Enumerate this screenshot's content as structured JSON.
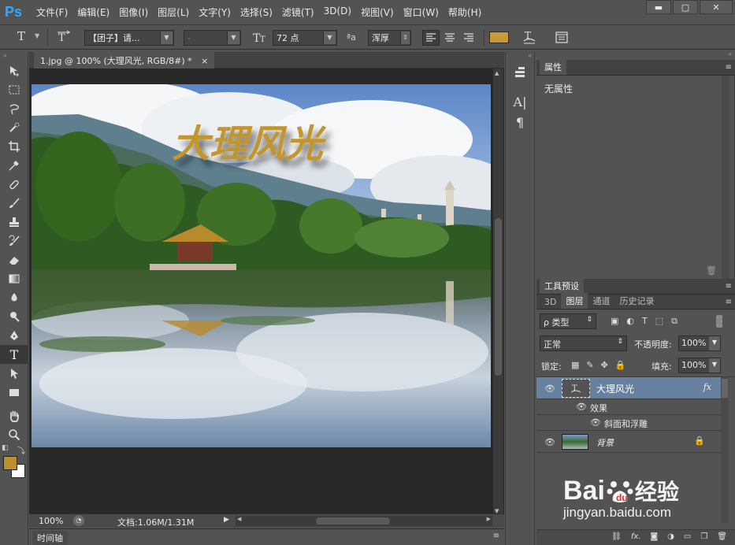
{
  "app": {
    "logo": "Ps",
    "menu": [
      "文件(F)",
      "编辑(E)",
      "图像(I)",
      "图层(L)",
      "文字(Y)",
      "选择(S)",
      "滤镜(T)",
      "3D(D)",
      "视图(V)",
      "窗口(W)",
      "帮助(H)"
    ],
    "window_controls": [
      "▬",
      "▢",
      "✕"
    ]
  },
  "options": {
    "font_family": "【团子】请...",
    "font_style": "-",
    "font_size": "72 点",
    "aa_label": "ªa",
    "antialias": "浑厚",
    "text_color": "#c89a3a"
  },
  "document": {
    "tab_title": "1.jpg @ 100% (大理风光, RGB/8#) *",
    "tab_close": "×",
    "canvas_title": "大理风光",
    "zoom": "100%",
    "doc_info": "文档:1.06M/1.31M",
    "timeline_label": "时间轴"
  },
  "colors": {
    "foreground": "#b8902f",
    "background": "#ffffff"
  },
  "properties": {
    "tab": "属性",
    "content": "无属性"
  },
  "tool_presets": {
    "tab": "工具预设"
  },
  "layers": {
    "tabs": [
      "3D",
      "图层",
      "通道",
      "历史记录"
    ],
    "filter_label": "ρ 类型",
    "blend_mode": "正常",
    "opacity_label": "不透明度:",
    "opacity_value": "100%",
    "lock_label": "锁定:",
    "fill_label": "填充:",
    "fill_value": "100%",
    "items": [
      {
        "name": "大理风光",
        "type": "text",
        "fx": "fx"
      },
      {
        "name": "效果",
        "type": "effect-group"
      },
      {
        "name": "斜面和浮雕",
        "type": "effect"
      },
      {
        "name": "背景",
        "type": "image"
      }
    ]
  },
  "watermark": {
    "brand": "Bai",
    "brand_suffix": "经验",
    "url": "jingyan.baidu.com"
  }
}
